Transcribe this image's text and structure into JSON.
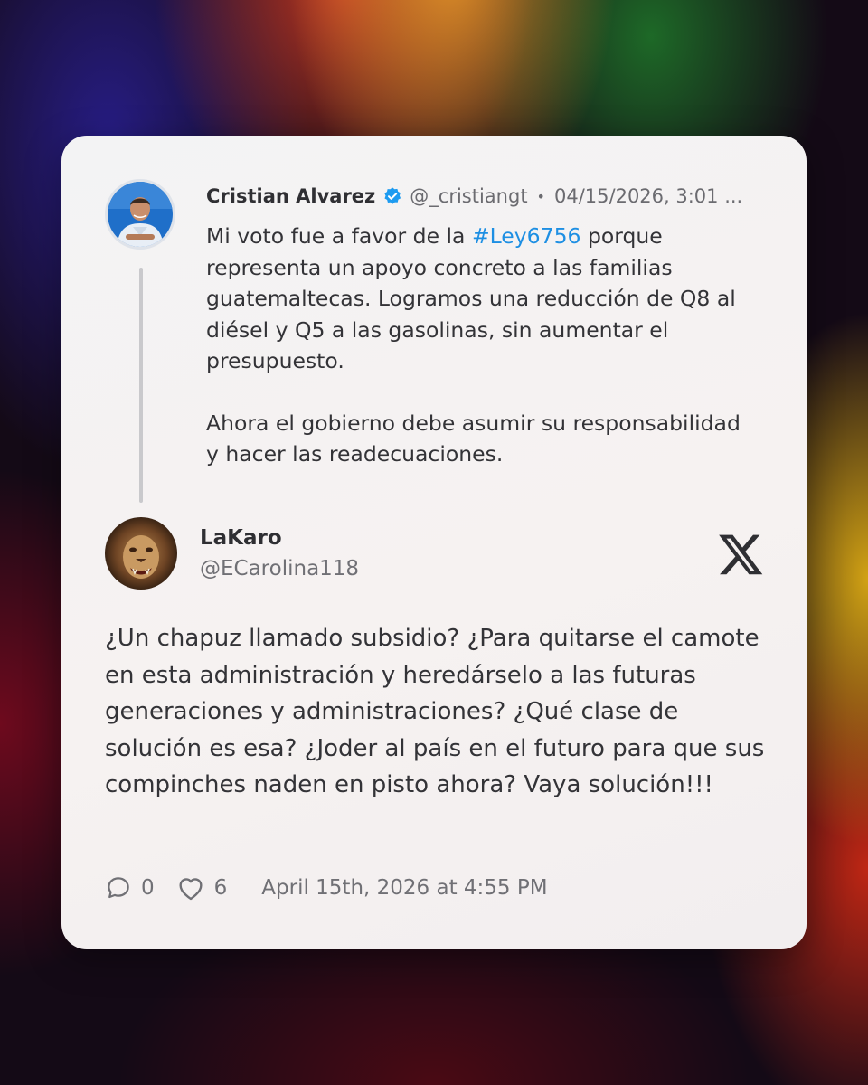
{
  "original_post": {
    "author_name": "Cristian Alvarez",
    "handle": "@_cristiangt",
    "separator": "•",
    "timestamp": "04/15/2026, 3:01 ...",
    "verified_icon": "verified-badge-icon",
    "text_before_hashtag": "Mi voto fue a favor de la ",
    "hashtag": "#Ley6756",
    "text_after_hashtag": " porque representa un apoyo concreto a las familias guatemaltecas. Logramos una reducción de Q8 al diésel y Q5 a las gasolinas, sin aumentar el presupuesto.",
    "paragraph_2": "Ahora el gobierno debe asumir su responsabilidad y hacer las readecuaciones."
  },
  "reply": {
    "author_name": "LaKaro",
    "handle": "@ECarolina118",
    "body": "¿Un chapuz llamado subsidio? ¿Para quitarse el camote en esta administración y heredárselo a las futuras generaciones y administraciones? ¿Qué clase de solución es esa? ¿Joder al país en el futuro para que sus compinches naden en pisto ahora? Vaya solución!!!",
    "reply_count": "0",
    "like_count": "6",
    "timestamp": "April 15th, 2026 at 4:55 PM"
  },
  "brand_icon": "x-logo-icon",
  "colors": {
    "hashtag": "#1d8fe3",
    "verified": "#1d9bf0",
    "card_background": "#f3f2f2",
    "primary_text": "#333337",
    "secondary_text": "#707075"
  }
}
